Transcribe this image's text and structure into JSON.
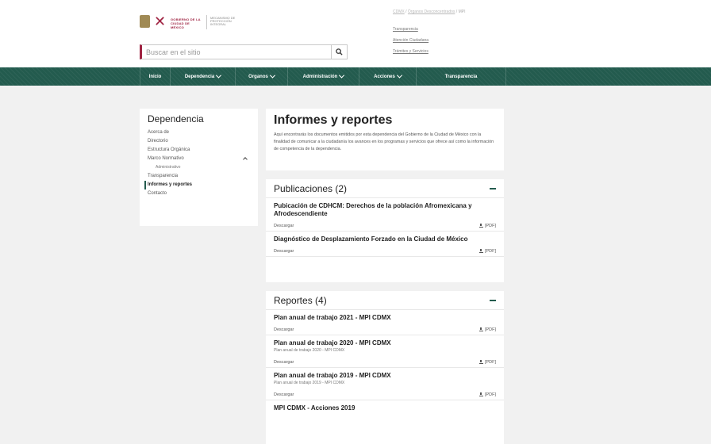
{
  "header": {
    "logo_text_1": "GOBIERNO DE LA CIUDAD DE MÉXICO",
    "logo_text_2": "MECANISMO DE PROTECCIÓN INTEGRAL",
    "search_placeholder": "Buscar en el sitio",
    "breadcrumb": [
      "CDMX",
      "Órganos Desconcentrados",
      "MPI"
    ],
    "breadcrumb_sep": "/",
    "quick_links": [
      "Transparencia",
      "Atención Ciudadana",
      "Trámites y Servicios"
    ]
  },
  "nav": {
    "items": [
      {
        "label": "Inicio",
        "dropdown": false,
        "width": 38
      },
      {
        "label": "Dependencia",
        "dropdown": true,
        "width": 82
      },
      {
        "label": "Organos",
        "dropdown": true,
        "width": 66
      },
      {
        "label": "Administración",
        "dropdown": true,
        "width": 90
      },
      {
        "label": "Acciones",
        "dropdown": true,
        "width": 72
      },
      {
        "label": "Transparencia",
        "dropdown": false,
        "width": 114
      }
    ]
  },
  "sidebar": {
    "title": "Dependencia",
    "items": [
      {
        "label": "Acerca de"
      },
      {
        "label": "Directorio"
      },
      {
        "label": "Estructura Orgánica"
      },
      {
        "label": "Marco Normativo"
      },
      {
        "label": "Administrativo"
      },
      {
        "label": "Transparencia"
      },
      {
        "label": "Informes y reportes"
      },
      {
        "label": "Contacto"
      }
    ]
  },
  "main": {
    "title": "Informes y reportes",
    "intro": "Aquí encontrarás los documentos emitidos por esta dependencia del Gobierno de la Ciudad de México con la finalidad de comunicar a la ciudadanía los avances en los programas y servicios que ofrece así como la información de competencia de la dependencia.",
    "publicaciones": {
      "title": "Publicaciones (2)",
      "docs": [
        {
          "title": "Pubicación de CDHCM: Derechos de la población Afromexicana y Afrodescendiente",
          "download": "Descargar",
          "format": "[PDF]"
        },
        {
          "title": "Diagnóstico de Desplazamiento Forzado en la Ciudad de México",
          "download": "Descargar",
          "format": "[PDF]"
        }
      ]
    },
    "reportes": {
      "title": "Reportes (4)",
      "docs": [
        {
          "title": "Plan anual de trabajo 2021 - MPI CDMX",
          "desc": "",
          "download": "Descargar",
          "format": "[PDF]"
        },
        {
          "title": "Plan anual de trabajo 2020 - MPI CDMX",
          "desc": "Plan anual de trabajo 2020 - MPI CDMX",
          "download": "Descargar",
          "format": "[PDF]"
        },
        {
          "title": "Plan anual de trabajo 2019 - MPI CDMX",
          "desc": "Plan anual de trabajo 2019 - MPI CDMX",
          "download": "Descargar",
          "format": "[PDF]"
        },
        {
          "title": "MPI CDMX - Acciones 2019",
          "desc": "",
          "download": "",
          "format": ""
        }
      ]
    }
  },
  "colors": {
    "brand_green": "#235b4e",
    "brand_red": "#9f2241",
    "gold": "#a08a55"
  }
}
